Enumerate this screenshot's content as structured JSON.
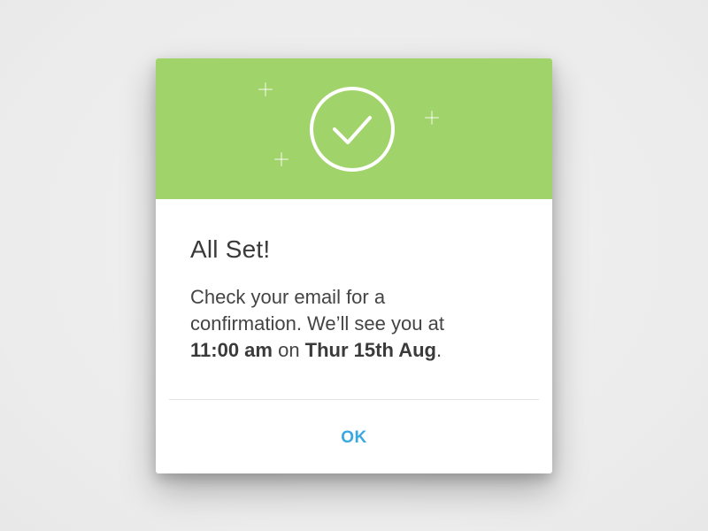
{
  "dialog": {
    "title": "All Set!",
    "message": {
      "line1": "Check your email for a",
      "line2": "confirmation. We’ll see you at",
      "time": "11:00 am",
      "on": " on ",
      "date": "Thur 15th Aug",
      "end": "."
    },
    "ok_label": "OK",
    "header_icon": "check-circle-icon",
    "decoration_icon": "plus-icon"
  },
  "colors": {
    "header_background": "#a1d36b",
    "accent": "#3aa8e0",
    "page_background": "#efefef"
  }
}
